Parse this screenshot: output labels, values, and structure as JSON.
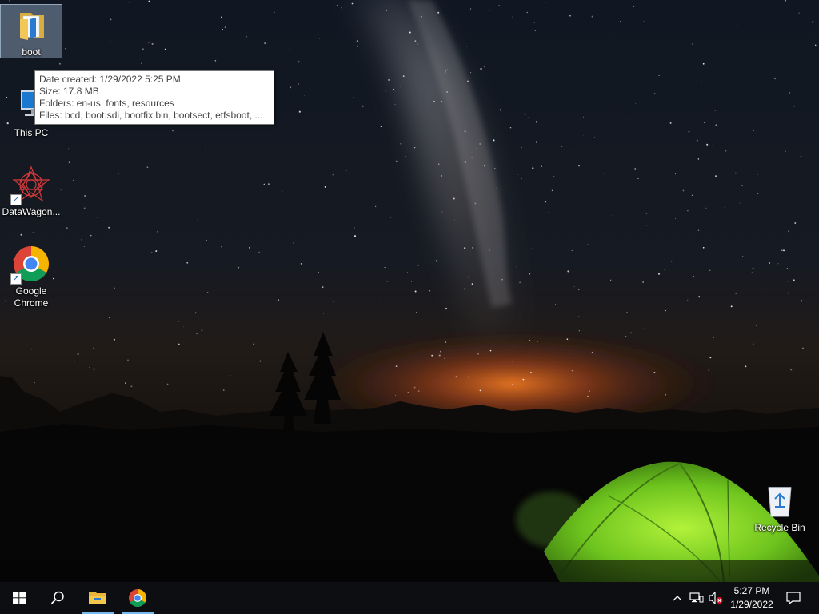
{
  "desktop": {
    "icons": [
      {
        "label": "boot",
        "icon": "folder-icon",
        "selected": true
      },
      {
        "label": "This PC",
        "icon": "computer-icon"
      },
      {
        "label": "DataWagon...",
        "icon": "datawagon-icon",
        "shortcut": true
      },
      {
        "label": "Google Chrome",
        "icon": "chrome-icon",
        "shortcut": true
      },
      {
        "label": "Recycle Bin",
        "icon": "recycle-bin-icon"
      }
    ]
  },
  "tooltip": {
    "date_created": "Date created: 1/29/2022 5:25 PM",
    "size": "Size: 17.8 MB",
    "folders": "Folders: en-us, fonts, resources",
    "files": "Files: bcd, boot.sdi, bootfix.bin, bootsect, etfsboot, ..."
  },
  "taskbar": {
    "start_icon": "windows-logo-icon",
    "search_icon": "search-icon",
    "pinned": [
      {
        "name": "File Explorer",
        "icon": "file-explorer-icon",
        "active": true
      },
      {
        "name": "Google Chrome",
        "icon": "chrome-icon",
        "active": true
      }
    ],
    "tray": {
      "icons": [
        "chevron-up-icon",
        "network-icon",
        "volume-muted-icon"
      ],
      "time": "5:27 PM",
      "date": "1/29/2022",
      "notification_icon": "action-center-icon"
    }
  },
  "colors": {
    "accent": "#76b9ed",
    "tent": "#7ed321",
    "sunset": "#e2601a"
  }
}
